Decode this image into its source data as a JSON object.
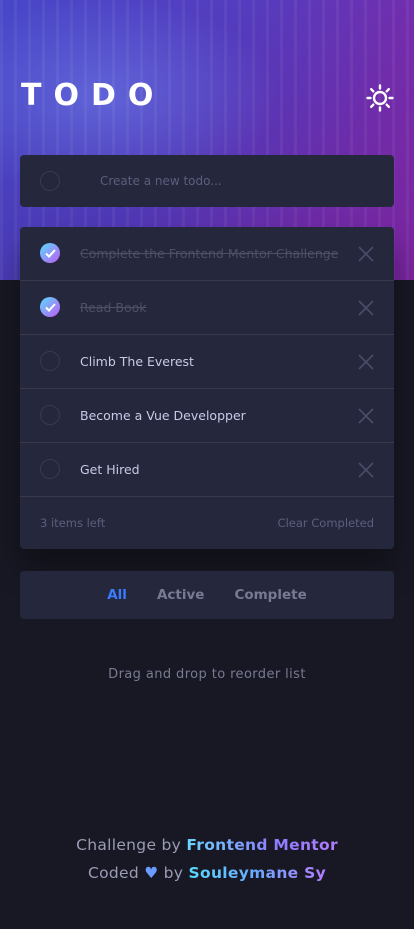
{
  "header": {
    "title": "TODO",
    "theme_icon": "sun-icon"
  },
  "new_todo": {
    "placeholder": "Create a new todo...",
    "value": ""
  },
  "todos": [
    {
      "text": "Complete the Frontend Mentor Challenge",
      "completed": true
    },
    {
      "text": "Read Book",
      "completed": true
    },
    {
      "text": "Climb The Everest",
      "completed": false
    },
    {
      "text": "Become a Vue Developper",
      "completed": false
    },
    {
      "text": "Get Hired",
      "completed": false
    }
  ],
  "list_footer": {
    "items_left": "3 items left",
    "clear_label": "Clear Completed"
  },
  "filters": {
    "all": "All",
    "active": "Active",
    "complete": "Complete",
    "selected": "All"
  },
  "hint": "Drag and drop to reorder list",
  "attribution": {
    "challenge_prefix": "Challenge by",
    "challenge_link": "Frontend Mentor",
    "coded_prefix": "Coded",
    "heart": "♥",
    "by": "by",
    "author_link": "Souleymane Sy"
  },
  "colors": {
    "accent": "#3a7cfd",
    "check_gradient_start": "#57ddff",
    "check_gradient_end": "#c058f3",
    "card_bg": "#25273c",
    "page_bg": "#181824"
  }
}
